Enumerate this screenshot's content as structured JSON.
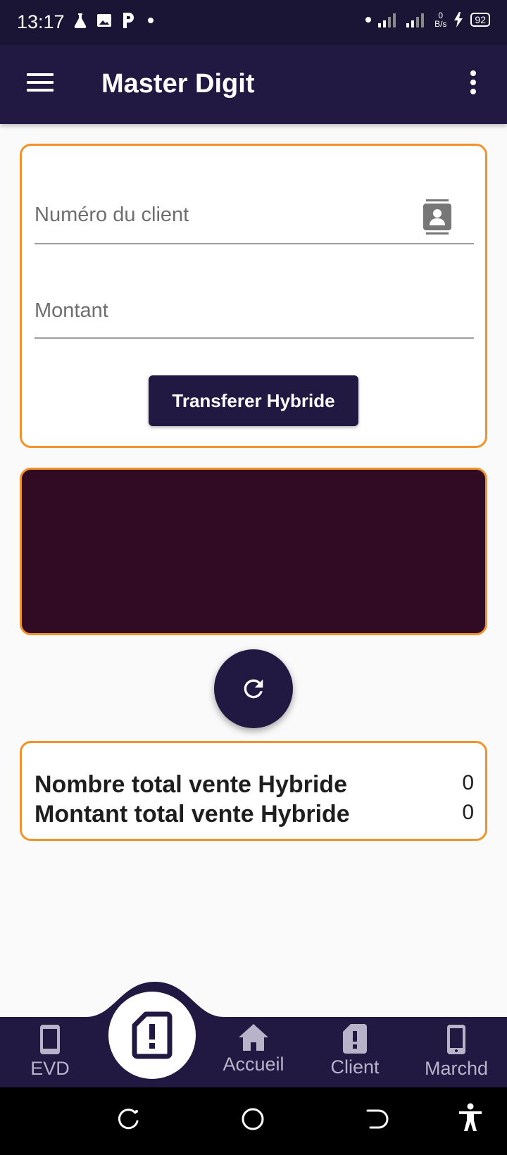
{
  "status_bar": {
    "time": "13:17",
    "net_speed_value": "0",
    "net_speed_unit": "B/s",
    "battery": "92"
  },
  "app_bar": {
    "title": "Master Digit"
  },
  "form": {
    "phone_placeholder": "Numéro du client",
    "amount_placeholder": "Montant",
    "transfer_button": "Transferer Hybride"
  },
  "stats": {
    "total_count_label": "Nombre total vente Hybride",
    "total_count_value": "0",
    "total_amount_label": "Montant total vente Hybride",
    "total_amount_value": "0"
  },
  "bottom_nav": {
    "items": [
      {
        "label": "EVD",
        "icon": "phone-icon"
      },
      {
        "label": "Accueil",
        "icon": "home-icon"
      },
      {
        "label": "Client",
        "icon": "sim-alert-icon"
      },
      {
        "label": "Marchd",
        "icon": "smartphone-icon"
      }
    ],
    "center_icon": "sim-alert-icon"
  },
  "colors": {
    "primary": "#221942",
    "accent_border": "#f0932b",
    "dark_panel": "#310b24",
    "background": "#fafafa"
  }
}
